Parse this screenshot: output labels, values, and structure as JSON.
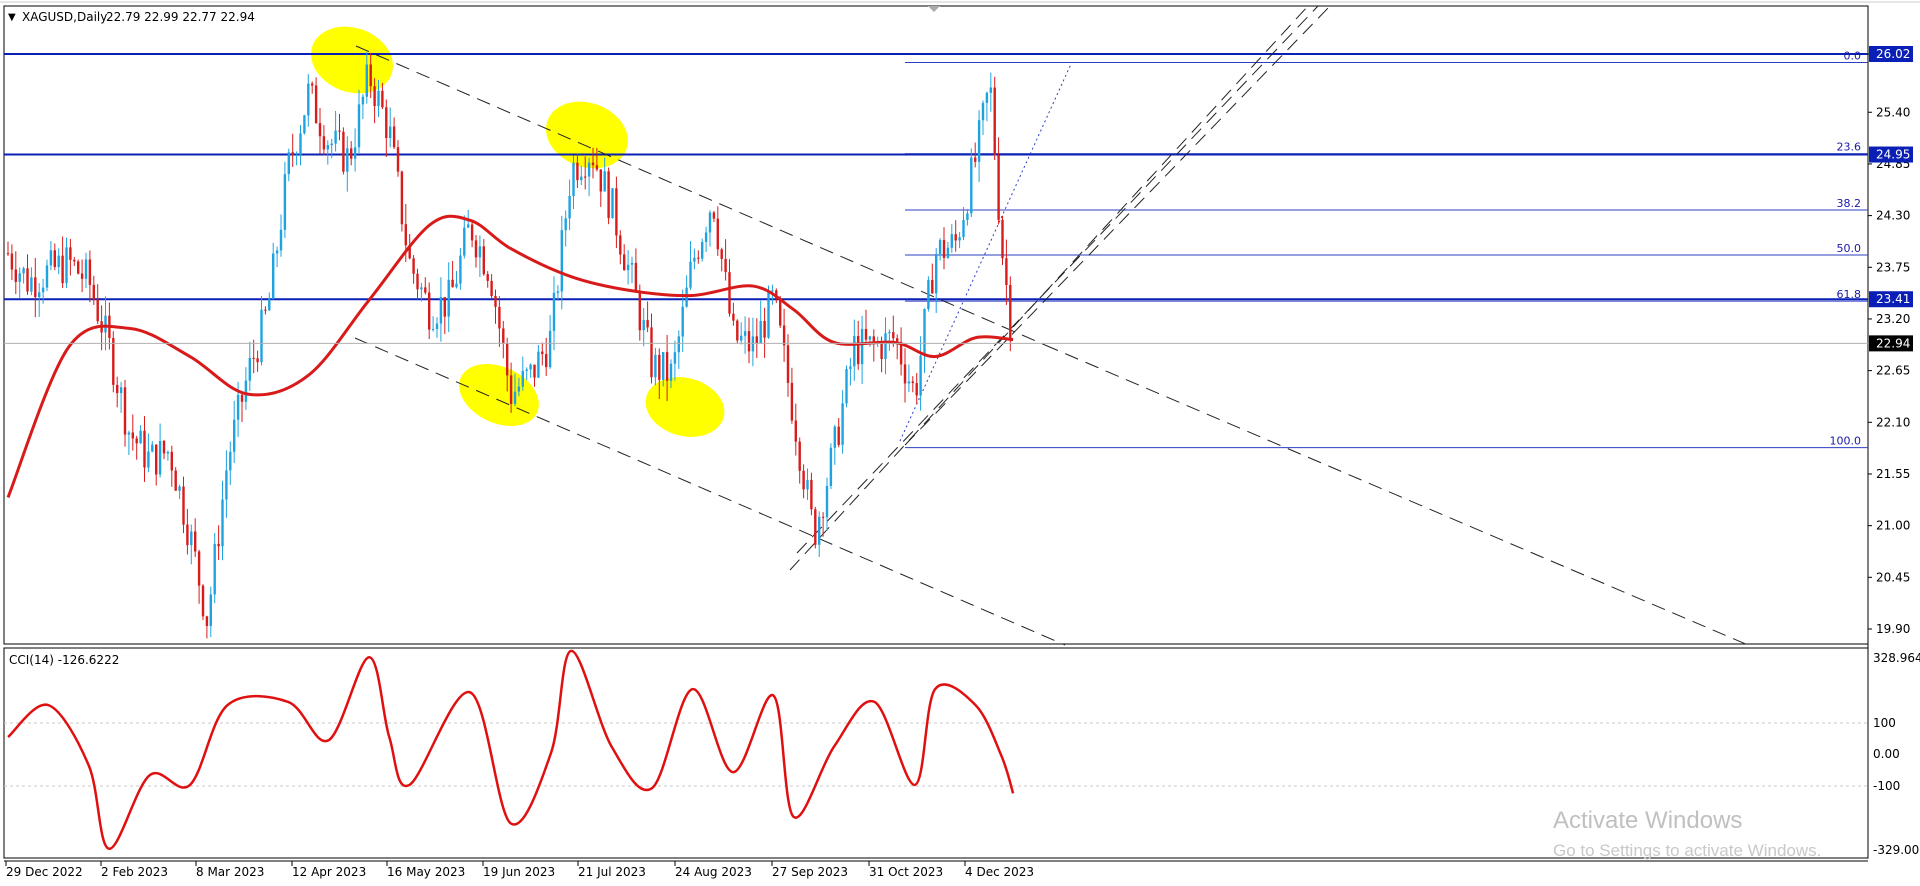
{
  "header": {
    "symbol": "XAGUSD,Daily",
    "ohlc": "22.79 22.99 22.77 22.94",
    "marker": "▼"
  },
  "indicator": {
    "label": "CCI(14) -126.6222",
    "axis_labels": [
      "328.964",
      "100",
      "0.00",
      "-100",
      "-329.000"
    ]
  },
  "price_axis": {
    "ticks": [
      "26.02",
      "25.40",
      "24.85",
      "24.30",
      "23.75",
      "23.20",
      "22.65",
      "22.10",
      "21.55",
      "21.00",
      "20.45",
      "19.90"
    ],
    "current_price": "22.94"
  },
  "horizontal_lines": [
    {
      "label": "26.02",
      "value": 26.02
    },
    {
      "label": "24.95",
      "value": 24.95
    },
    {
      "label": "23.41",
      "value": 23.41
    }
  ],
  "fibonacci": {
    "levels": [
      {
        "label": "0.0",
        "value": 25.93
      },
      {
        "label": "23.6",
        "value": 24.96
      },
      {
        "label": "38.2",
        "value": 24.36
      },
      {
        "label": "50.0",
        "value": 23.88
      },
      {
        "label": "61.8",
        "value": 23.39
      },
      {
        "label": "100.0",
        "value": 21.83
      }
    ]
  },
  "time_axis": {
    "labels": [
      "29 Dec 2022",
      "2 Feb 2023",
      "8 Mar 2023",
      "12 Apr 2023",
      "16 May 2023",
      "19 Jun 2023",
      "21 Jul 2023",
      "24 Aug 2023",
      "27 Sep 2023",
      "31 Oct 2023",
      "4 Dec 2023"
    ]
  },
  "watermark": {
    "line1": "Activate Windows",
    "line2": "Go to Settings to activate Windows."
  },
  "colors": {
    "bull_candle": "#1ea3e0",
    "bear_candle": "#d81b1b",
    "moving_average": "#d91a1a",
    "cci_line": "#e01010",
    "horizontal_line": "#0a1fb5",
    "fib_line": "#2b3fc2",
    "highlight": "#ffff00",
    "price_label_bg": "#0a1fb5"
  },
  "chart_data": {
    "type": "candlestick",
    "title": "XAGUSD,Daily",
    "ylim": [
      19.6,
      26.35
    ],
    "x_dates": [
      "29 Dec 2022",
      "2 Feb 2023",
      "8 Mar 2023",
      "12 Apr 2023",
      "16 May 2023",
      "19 Jun 2023",
      "21 Jul 2023",
      "24 Aug 2023",
      "27 Sep 2023",
      "31 Oct 2023",
      "4 Dec 2023"
    ],
    "close_path": [
      [
        "2022-12-29",
        23.9
      ],
      [
        "2023-01-05",
        23.6
      ],
      [
        "2023-01-12",
        23.7
      ],
      [
        "2023-01-19",
        23.8
      ],
      [
        "2023-01-26",
        23.6
      ],
      [
        "2023-02-02",
        22.9
      ],
      [
        "2023-02-09",
        22.0
      ],
      [
        "2023-02-16",
        21.7
      ],
      [
        "2023-02-23",
        21.8
      ],
      [
        "2023-03-02",
        20.9
      ],
      [
        "2023-03-08",
        20.0
      ],
      [
        "2023-03-15",
        21.7
      ],
      [
        "2023-03-22",
        22.6
      ],
      [
        "2023-03-29",
        23.3
      ],
      [
        "2023-04-05",
        24.8
      ],
      [
        "2023-04-12",
        25.6
      ],
      [
        "2023-04-19",
        25.1
      ],
      [
        "2023-04-26",
        24.9
      ],
      [
        "2023-05-03",
        25.8
      ],
      [
        "2023-05-10",
        25.2
      ],
      [
        "2023-05-17",
        23.8
      ],
      [
        "2023-05-24",
        23.3
      ],
      [
        "2023-05-31",
        23.4
      ],
      [
        "2023-06-07",
        24.2
      ],
      [
        "2023-06-14",
        23.7
      ],
      [
        "2023-06-21",
        22.4
      ],
      [
        "2023-06-28",
        22.6
      ],
      [
        "2023-07-05",
        23.0
      ],
      [
        "2023-07-12",
        24.8
      ],
      [
        "2023-07-19",
        25.0
      ],
      [
        "2023-07-26",
        24.4
      ],
      [
        "2023-08-02",
        23.6
      ],
      [
        "2023-08-09",
        22.7
      ],
      [
        "2023-08-16",
        22.6
      ],
      [
        "2023-08-23",
        23.8
      ],
      [
        "2023-08-30",
        24.5
      ],
      [
        "2023-09-06",
        23.0
      ],
      [
        "2023-09-13",
        22.9
      ],
      [
        "2023-09-20",
        23.4
      ],
      [
        "2023-09-27",
        22.2
      ],
      [
        "2023-10-04",
        20.9
      ],
      [
        "2023-10-11",
        21.8
      ],
      [
        "2023-10-18",
        22.9
      ],
      [
        "2023-10-25",
        22.9
      ],
      [
        "2023-11-01",
        23.0
      ],
      [
        "2023-11-08",
        22.4
      ],
      [
        "2023-11-15",
        23.9
      ],
      [
        "2023-11-22",
        24.0
      ],
      [
        "2023-11-29",
        24.9
      ],
      [
        "2023-12-04",
        25.7
      ],
      [
        "2023-12-08",
        24.0
      ],
      [
        "2023-12-12",
        22.94
      ]
    ],
    "moving_average": [
      [
        "2022-12-29",
        21.3
      ],
      [
        "2023-01-19",
        22.9
      ],
      [
        "2023-02-09",
        23.1
      ],
      [
        "2023-03-02",
        22.8
      ],
      [
        "2023-03-22",
        22.4
      ],
      [
        "2023-04-12",
        22.6
      ],
      [
        "2023-05-03",
        23.4
      ],
      [
        "2023-05-24",
        24.2
      ],
      [
        "2023-06-07",
        24.25
      ],
      [
        "2023-06-21",
        23.95
      ],
      [
        "2023-07-12",
        23.65
      ],
      [
        "2023-08-02",
        23.5
      ],
      [
        "2023-08-23",
        23.45
      ],
      [
        "2023-09-13",
        23.55
      ],
      [
        "2023-09-27",
        23.3
      ],
      [
        "2023-10-11",
        22.95
      ],
      [
        "2023-11-01",
        22.95
      ],
      [
        "2023-11-15",
        22.8
      ],
      [
        "2023-11-29",
        23.0
      ],
      [
        "2023-12-12",
        22.98
      ]
    ],
    "cci": [
      [
        "2022-12-29",
        50
      ],
      [
        "2023-01-12",
        150
      ],
      [
        "2023-01-26",
        -40
      ],
      [
        "2023-02-02",
        -300
      ],
      [
        "2023-02-16",
        -70
      ],
      [
        "2023-03-02",
        -100
      ],
      [
        "2023-03-15",
        150
      ],
      [
        "2023-04-05",
        160
      ],
      [
        "2023-04-19",
        40
      ],
      [
        "2023-05-03",
        300
      ],
      [
        "2023-05-10",
        50
      ],
      [
        "2023-05-17",
        -100
      ],
      [
        "2023-06-07",
        190
      ],
      [
        "2023-06-21",
        -220
      ],
      [
        "2023-07-05",
        0
      ],
      [
        "2023-07-12",
        320
      ],
      [
        "2023-07-26",
        20
      ],
      [
        "2023-08-09",
        -110
      ],
      [
        "2023-08-23",
        200
      ],
      [
        "2023-09-06",
        -60
      ],
      [
        "2023-09-20",
        180
      ],
      [
        "2023-09-27",
        -200
      ],
      [
        "2023-10-11",
        20
      ],
      [
        "2023-10-25",
        160
      ],
      [
        "2023-11-08",
        -100
      ],
      [
        "2023-11-15",
        200
      ],
      [
        "2023-11-29",
        150
      ],
      [
        "2023-12-08",
        -10
      ],
      [
        "2023-12-12",
        -126.6
      ]
    ],
    "cci_range": [
      -329,
      328.964
    ],
    "grid": false,
    "legend": "none"
  }
}
